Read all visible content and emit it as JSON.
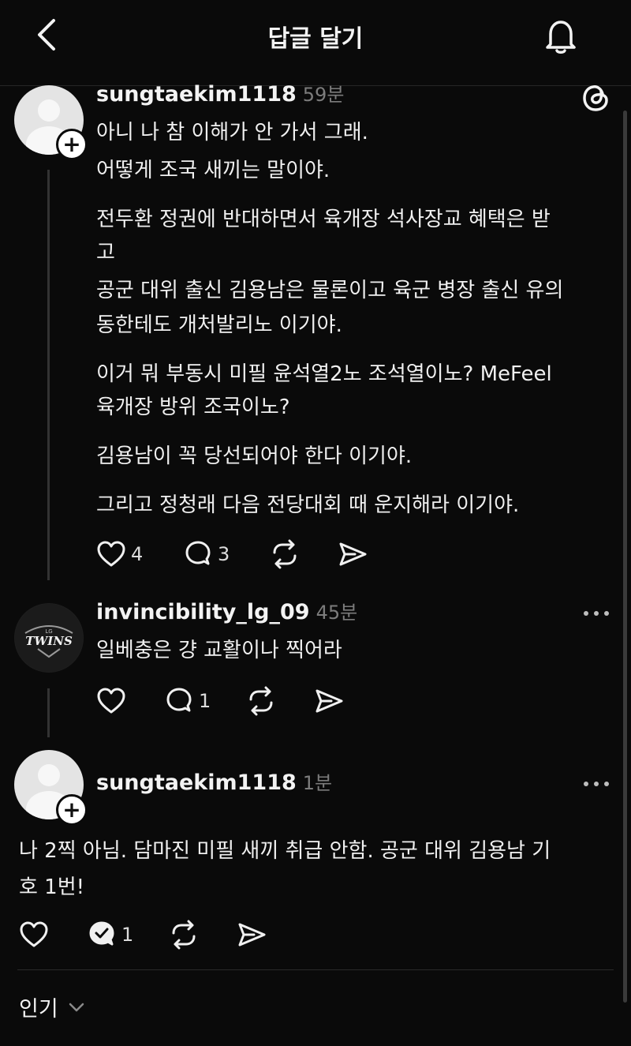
{
  "header": {
    "title": "답글 달기"
  },
  "posts": [
    {
      "username": "sungtaekim1118",
      "time": "59분",
      "paragraphs": [
        [
          "아니 나 참 이해가 안 가서 그래.",
          "어떻게 조국 새끼는 말이야."
        ],
        [
          "전두환 정권에 반대하면서 육개장 석사장교 혜택은 받",
          "고",
          "공군 대위 출신 김용남은 물론이고 육군 병장 출신 유의",
          "동한테도 개처발리노 이기야."
        ],
        [
          "이거 뭐 부동시 미필 윤석열2노 조석열이노? MeFeel",
          "육개장 방위 조국이노?"
        ],
        [
          "김용남이 꼭 당선되어야 한다 이기야."
        ],
        [
          "그리고 정청래 다음 전당대회 때 운지해라 이기야."
        ]
      ],
      "likes": "4",
      "replies": "3"
    },
    {
      "username": "invincibility_lg_09",
      "time": "45분",
      "avatar_text": "TWINS",
      "avatar_logo_text": "LG",
      "lines": [
        "일베충은 걍 교활이나 찍어라"
      ],
      "likes": "",
      "replies": "1"
    },
    {
      "username": "sungtaekim1118",
      "time": "1분",
      "lines": [
        "나 2찍 아님. 담마진 미필 새끼 취급 안함. 공군 대위 김용남 기",
        "호 1번!"
      ],
      "likes": "",
      "replies": "1"
    }
  ],
  "sort": {
    "label": "인기"
  },
  "icons": [
    "back-icon",
    "bell-icon",
    "threads-logo-icon",
    "heart-icon",
    "comment-icon",
    "repost-icon",
    "share-icon",
    "more-icon",
    "chevron-down-icon"
  ]
}
